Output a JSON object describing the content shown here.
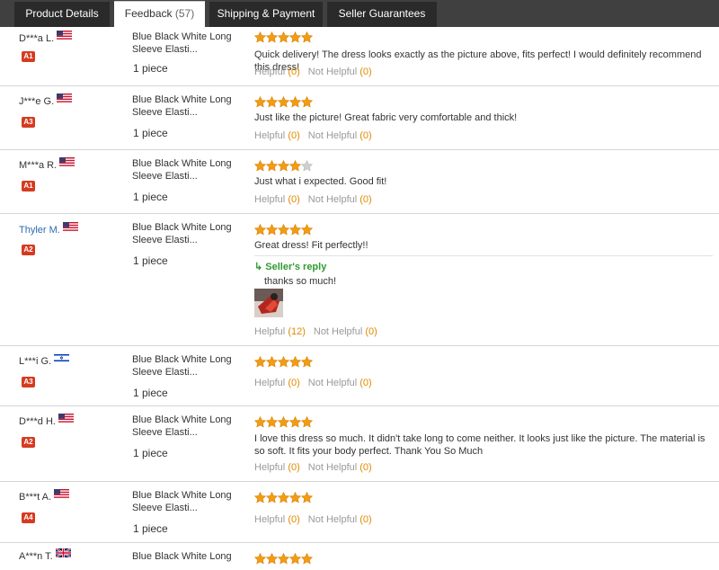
{
  "tabs": [
    {
      "label": "Product Details",
      "count": ""
    },
    {
      "label": "Feedback",
      "count": "(57)"
    },
    {
      "label": "Shipping & Payment",
      "count": ""
    },
    {
      "label": "Seller Guarantees",
      "count": ""
    }
  ],
  "colors": {
    "star": "#f39c12",
    "star_empty": "#cfcfcf",
    "level_badge": "#d63b1f",
    "helpful_count": "#e08a00",
    "reply_title": "#2f9a2f"
  },
  "labels": {
    "helpful": "Helpful",
    "not_helpful": "Not Helpful",
    "sellers_reply": "Seller's reply"
  },
  "reviews": [
    {
      "user": "D***a L.",
      "flag": "us-flag-icon",
      "level": "A1",
      "product": "Blue Black White Long Sleeve Elasti...",
      "quantity": "1 piece",
      "rating": 5,
      "comment": "Quick delivery! The dress looks exactly as the picture above, fits perfect! I would definitely recommend this dress!",
      "helpful": "(0)",
      "not_helpful": "(0)"
    },
    {
      "user": "J***e G.",
      "flag": "us-flag-icon",
      "level": "A3",
      "product": "Blue Black White Long Sleeve Elasti...",
      "quantity": "1 piece",
      "rating": 5,
      "comment": "Just like the picture! Great fabric very comfortable and thick!",
      "helpful": "(0)",
      "not_helpful": "(0)"
    },
    {
      "user": "M***a R.",
      "flag": "us-flag-icon",
      "level": "A1",
      "product": "Blue Black White Long Sleeve Elasti...",
      "quantity": "1 piece",
      "rating": 4,
      "comment": "Just what i expected. Good fit!",
      "helpful": "(0)",
      "not_helpful": "(0)"
    },
    {
      "user": "Thyler M.",
      "flag": "us-flag-icon",
      "level": "A2",
      "product": "Blue Black White Long Sleeve Elasti...",
      "quantity": "1 piece",
      "rating": 5,
      "comment": "Great dress! Fit perfectly!!",
      "reply": "thanks so much!",
      "helpful": "(12)",
      "not_helpful": "(0)"
    },
    {
      "user": "L***i G.",
      "flag": "il-flag-icon",
      "level": "A3",
      "product": "Blue Black White Long Sleeve Elasti...",
      "quantity": "1 piece",
      "rating": 5,
      "comment": "",
      "helpful": "(0)",
      "not_helpful": "(0)"
    },
    {
      "user": "D***d H.",
      "flag": "us-flag-icon",
      "level": "A2",
      "product": "Blue Black White Long Sleeve Elasti...",
      "quantity": "1 piece",
      "rating": 5,
      "comment": "I love this dress so much. It didn't take long to come neither. It looks just like the picture. The material is so soft. It fits your body perfect. Thank You So Much",
      "helpful": "(0)",
      "not_helpful": "(0)"
    },
    {
      "user": "B***t A.",
      "flag": "us-flag-icon",
      "level": "A4",
      "product": "Blue Black White Long Sleeve Elasti...",
      "quantity": "1 piece",
      "rating": 5,
      "comment": "",
      "helpful": "(0)",
      "not_helpful": "(0)"
    },
    {
      "user": "A***n T.",
      "flag": "uk-flag-icon",
      "level": "",
      "product": "Blue Black White Long",
      "quantity": "",
      "rating": 5,
      "comment": "",
      "helpful": "",
      "not_helpful": ""
    }
  ]
}
